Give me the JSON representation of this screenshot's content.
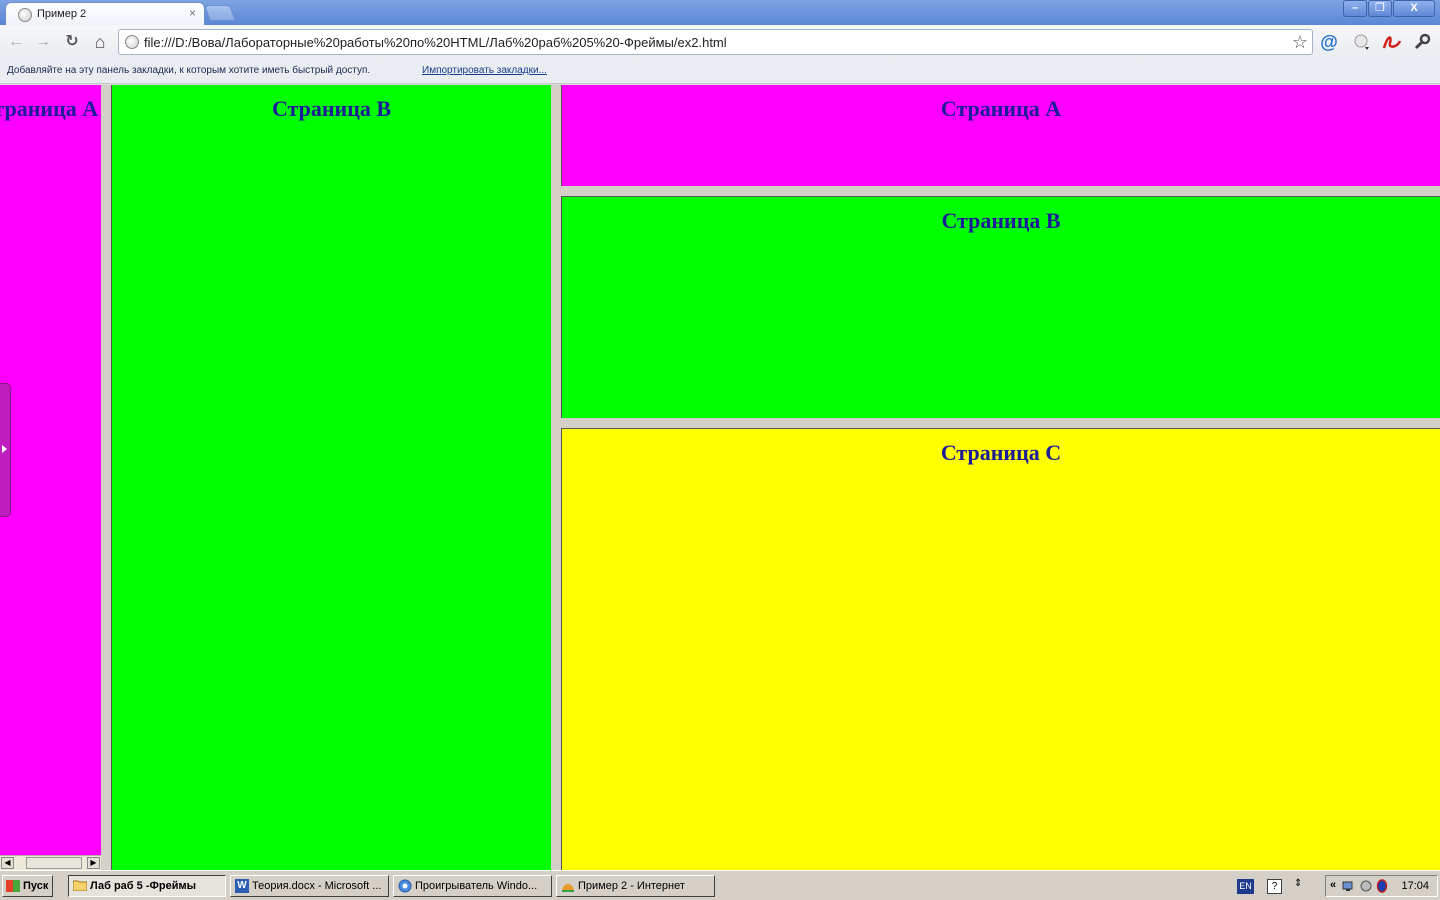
{
  "browser": {
    "tab_title": "Пример 2",
    "tab_close": "×",
    "url": "file:///D:/Вова/Лабораторные%20работы%20по%20HTML/Лаб%20раб%205%20-Фреймы/ex2.html",
    "window_buttons": {
      "minimize": "–",
      "restore": "❐",
      "close": "X"
    }
  },
  "toolbar": {
    "back": "←",
    "forward": "→",
    "reload": "↻",
    "home": "⌂",
    "star": "☆",
    "at": "@"
  },
  "bookmarks_bar": {
    "text": "Добавляйте на эту панель закладки, к которым хотите иметь быстрый доступ.",
    "import_link": "Импортировать закладки..."
  },
  "frames": {
    "left_a": "Страница А",
    "left_b": "Страница В",
    "right_a": "Страница А",
    "right_b": "Страница В",
    "right_c": "Страница С",
    "colors": {
      "magenta": "#ff00ff",
      "green": "#00ff00",
      "yellow": "#ffff00"
    }
  },
  "taskbar": {
    "start": "Пуск",
    "tasks": [
      {
        "label": "Лаб раб 5 -Фреймы",
        "active": true
      },
      {
        "label": "Теория.docx - Microsoft ...",
        "active": false
      },
      {
        "label": "Проигрыватель Windo...",
        "active": false
      },
      {
        "label": "Пример 2 - Интернет",
        "active": false
      }
    ],
    "lang": "EN",
    "help": "?",
    "tray_arrows": "«",
    "time": "17:04"
  }
}
